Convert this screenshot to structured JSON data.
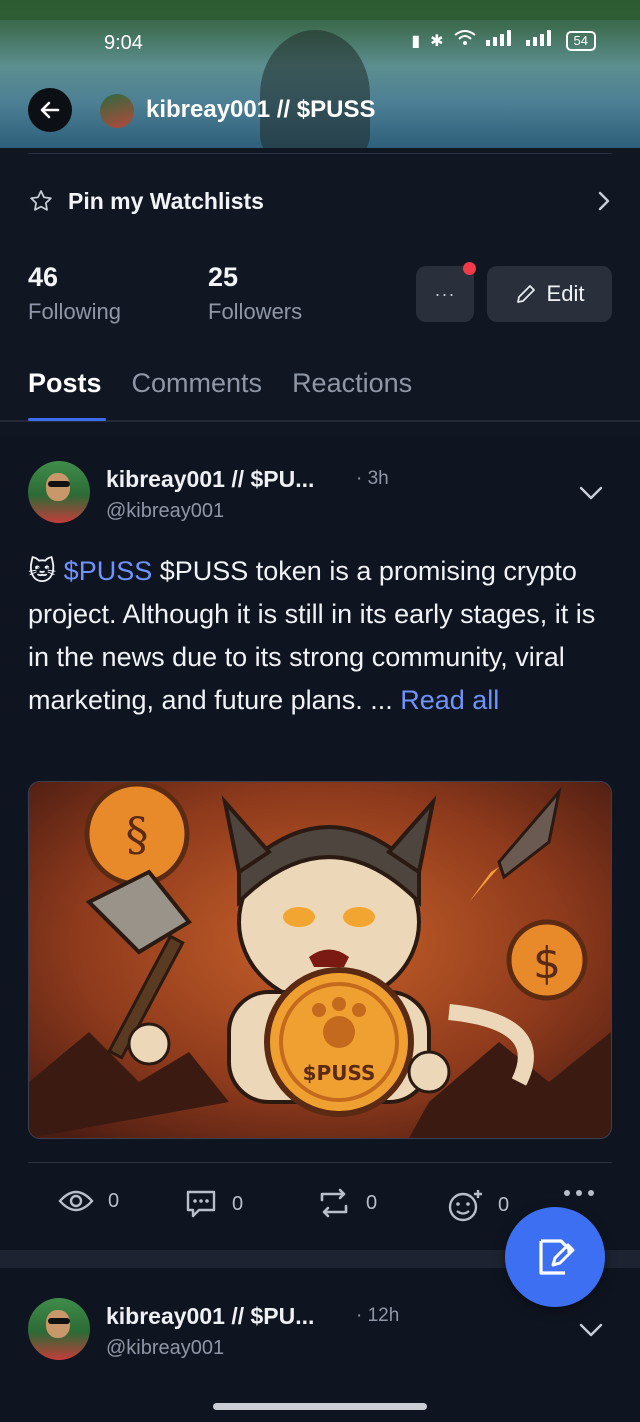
{
  "status": {
    "time": "9:04",
    "battery": "54"
  },
  "header": {
    "title": "kibreay001 // $PUSS"
  },
  "watchlist": {
    "label": "Pin my Watchlists"
  },
  "stats": {
    "following_count": "46",
    "following_label": "Following",
    "followers_count": "25",
    "followers_label": "Followers"
  },
  "buttons": {
    "more_label": "···",
    "edit_label": "Edit"
  },
  "tabs": [
    {
      "label": "Posts",
      "active": true
    },
    {
      "label": "Comments",
      "active": false
    },
    {
      "label": "Reactions",
      "active": false
    }
  ],
  "posts": [
    {
      "author": "kibreay001 // $PU...",
      "time": "· 3h",
      "handle": "@kibreay001",
      "emoji": "🐱",
      "tag": "$PUSS",
      "body": " $PUSS token is a promising crypto project. Although it is still in its early stages, it is in the news due to its strong community, viral marketing, and future plans. ... ",
      "read_all": "Read all",
      "image_text": "$PUSS",
      "actions": {
        "views": "0",
        "comments": "0",
        "reposts": "0",
        "reactions": "0"
      }
    },
    {
      "author": "kibreay001 // $PU...",
      "time": "· 12h",
      "handle": "@kibreay001"
    }
  ],
  "colors": {
    "accent": "#3d6ff2",
    "link": "#6e93ff",
    "alert": "#ef3a4a",
    "background": "#111722"
  }
}
